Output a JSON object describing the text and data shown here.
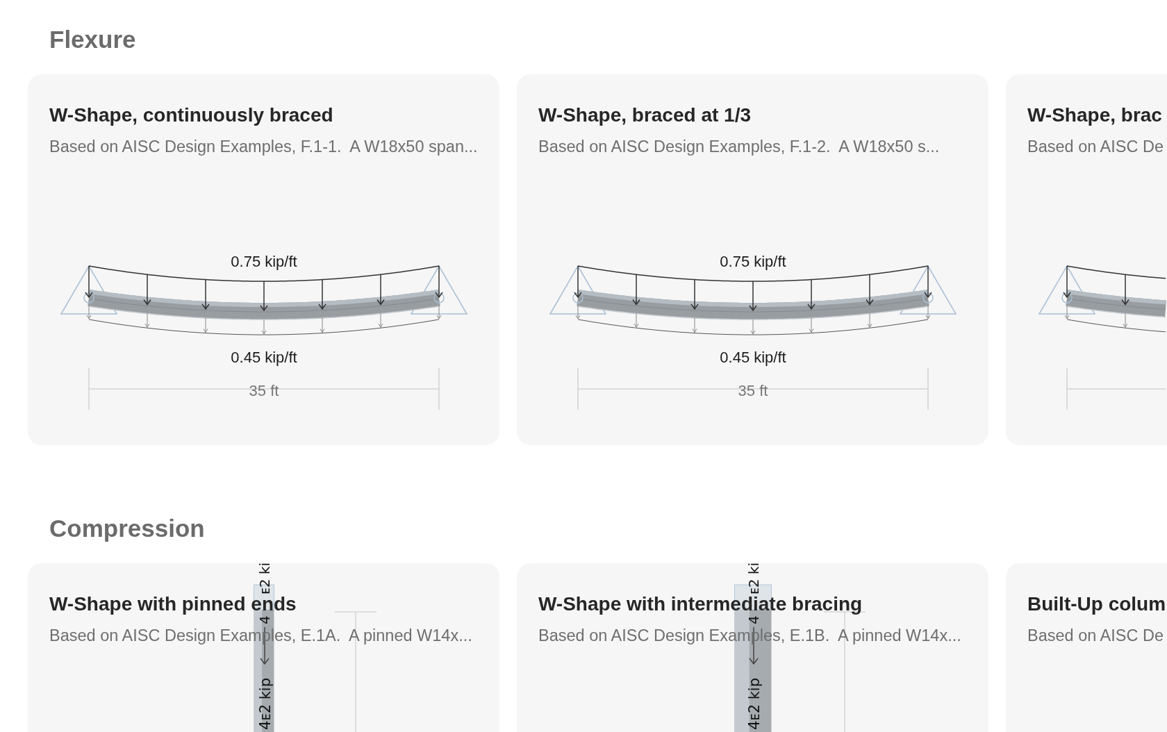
{
  "sections": [
    {
      "title": "Flexure",
      "cards": [
        {
          "title": "W-Shape, continuously braced",
          "description": "Based on AISC Design Examples, F.1-1.  A W18x50 span...",
          "diagram": {
            "kind": "beam",
            "top_load": "0.75 kip/ft",
            "bottom_load": "0.45 kip/ft",
            "span": "35 ft"
          }
        },
        {
          "title": "W-Shape, braced at 1/3",
          "description": "Based on AISC Design Examples, F.1-2.  A W18x50 s...",
          "diagram": {
            "kind": "beam",
            "top_load": "0.75 kip/ft",
            "bottom_load": "0.45 kip/ft",
            "span": "35 ft"
          }
        },
        {
          "title": "W-Shape, brac",
          "description": "Based on AISC De",
          "diagram": {
            "kind": "beam"
          }
        }
      ]
    },
    {
      "title": "Compression",
      "cards": [
        {
          "title": "W-Shape with pinned ends",
          "description": "Based on AISC Design Examples, E.1A.  A pinned W14x...",
          "diagram": {
            "kind": "column",
            "top_load_parts": [
              "4",
              "ᴇ2 ki"
            ],
            "bottom_load": "4ᴇ2 kip"
          }
        },
        {
          "title": "W-Shape with intermediate bracing",
          "description": "Based on AISC Design Examples, E.1B.  A pinned W14x...",
          "diagram": {
            "kind": "column",
            "top_load_parts": [
              "4",
              "ᴇ2 ki"
            ],
            "bottom_load": "4ᴇ2 kip"
          }
        },
        {
          "title": "Built-Up colum",
          "description": "Based on AISC De"
        }
      ]
    }
  ]
}
